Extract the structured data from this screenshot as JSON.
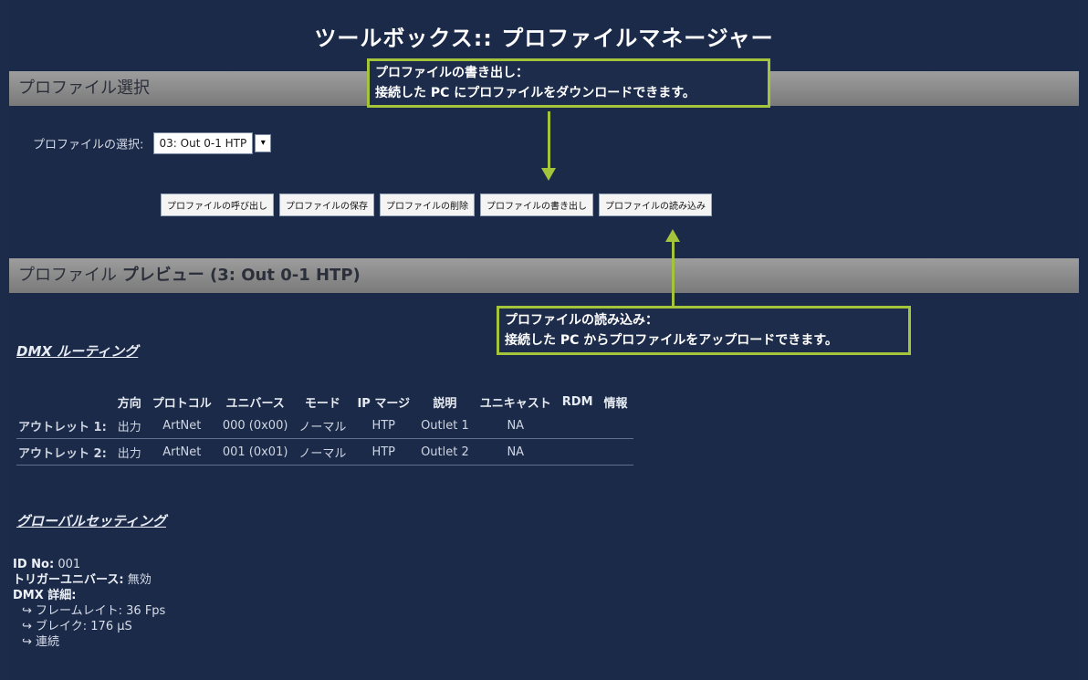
{
  "page_title": "ツールボックス:: プロファイルマネージャー",
  "section_select": {
    "label": "プロファイル選択"
  },
  "profile_select": {
    "label": "プロファイルの選択:",
    "value": "03: Out 0-1 HTP",
    "arrow": "▾"
  },
  "buttons": [
    "プロファイルの呼び出し",
    "プロファイルの保存",
    "プロファイルの削除",
    "プロファイルの書き出し",
    "プロファイルの読み込み"
  ],
  "callout_export": {
    "line1": "プロファイルの書き出し：",
    "line2": "接続した PC にプロファイルをダウンロードできます。"
  },
  "callout_import": {
    "line1": "プロファイルの読み込み：",
    "line2": "接続した PC からプロファイルをアップロードできます。"
  },
  "section_preview": {
    "label_prefix": "プロファイル",
    "label_bold": "プレビュー (3: Out 0-1 HTP)"
  },
  "dmx_routing": {
    "heading": "DMX ルーティング",
    "columns": [
      "",
      "方向",
      "プロトコル",
      "ユニバース",
      "モード",
      "IP マージ",
      "説明",
      "ユニキャスト",
      "RDM",
      "情報"
    ],
    "rows": [
      [
        "アウトレット 1:",
        "出力",
        "ArtNet",
        "000 (0x00)",
        "ノーマル",
        "HTP",
        "Outlet 1",
        "NA",
        "",
        ""
      ],
      [
        "アウトレット 2:",
        "出力",
        "ArtNet",
        "001 (0x01)",
        "ノーマル",
        "HTP",
        "Outlet 2",
        "NA",
        "",
        ""
      ]
    ]
  },
  "global_settings": {
    "heading": "グローバルセッティング",
    "id_label": "ID No:",
    "id_value": "001",
    "trigger_label": "トリガーユニバース:",
    "trigger_value": "無効",
    "dmx_detail_label": "DMX 詳細:",
    "frame_rate": "↪ フレームレイト: 36 Fps",
    "break": "↪ ブレイク: 176 µS",
    "continuous": "↪ 連続"
  },
  "colors": {
    "background": "#1b2a48",
    "section_bar": "#8c8c8c",
    "callout_border": "#a4c43c"
  }
}
